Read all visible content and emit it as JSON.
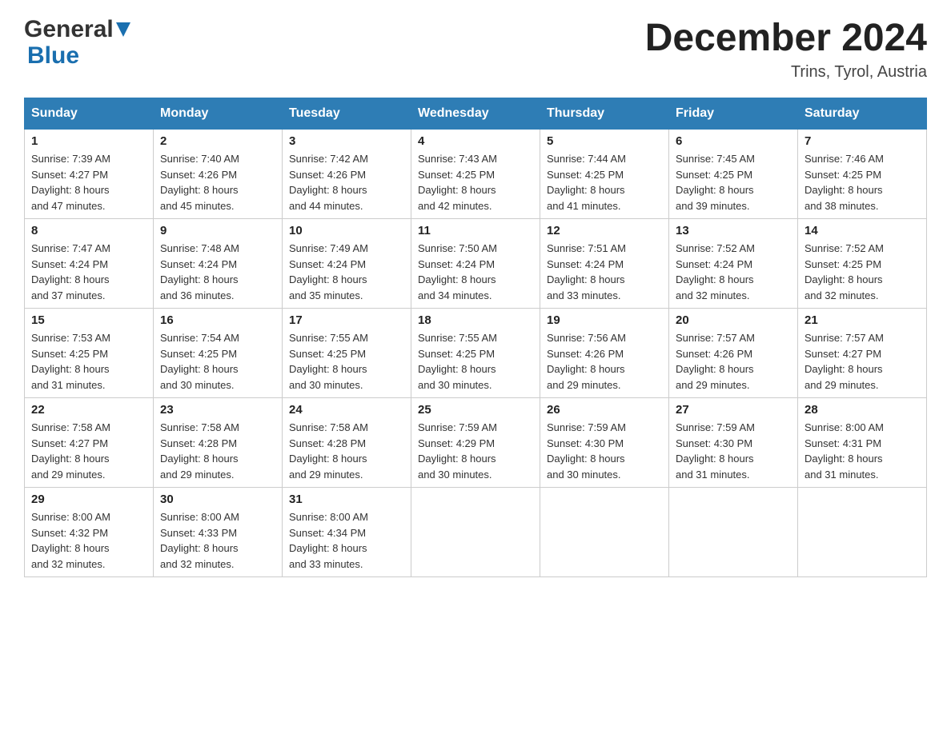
{
  "header": {
    "logo_general": "General",
    "logo_blue": "Blue",
    "month_title": "December 2024",
    "location": "Trins, Tyrol, Austria"
  },
  "days_of_week": [
    "Sunday",
    "Monday",
    "Tuesday",
    "Wednesday",
    "Thursday",
    "Friday",
    "Saturday"
  ],
  "weeks": [
    [
      {
        "day": "1",
        "sunrise": "7:39 AM",
        "sunset": "4:27 PM",
        "daylight": "8 hours and 47 minutes."
      },
      {
        "day": "2",
        "sunrise": "7:40 AM",
        "sunset": "4:26 PM",
        "daylight": "8 hours and 45 minutes."
      },
      {
        "day": "3",
        "sunrise": "7:42 AM",
        "sunset": "4:26 PM",
        "daylight": "8 hours and 44 minutes."
      },
      {
        "day": "4",
        "sunrise": "7:43 AM",
        "sunset": "4:25 PM",
        "daylight": "8 hours and 42 minutes."
      },
      {
        "day": "5",
        "sunrise": "7:44 AM",
        "sunset": "4:25 PM",
        "daylight": "8 hours and 41 minutes."
      },
      {
        "day": "6",
        "sunrise": "7:45 AM",
        "sunset": "4:25 PM",
        "daylight": "8 hours and 39 minutes."
      },
      {
        "day": "7",
        "sunrise": "7:46 AM",
        "sunset": "4:25 PM",
        "daylight": "8 hours and 38 minutes."
      }
    ],
    [
      {
        "day": "8",
        "sunrise": "7:47 AM",
        "sunset": "4:24 PM",
        "daylight": "8 hours and 37 minutes."
      },
      {
        "day": "9",
        "sunrise": "7:48 AM",
        "sunset": "4:24 PM",
        "daylight": "8 hours and 36 minutes."
      },
      {
        "day": "10",
        "sunrise": "7:49 AM",
        "sunset": "4:24 PM",
        "daylight": "8 hours and 35 minutes."
      },
      {
        "day": "11",
        "sunrise": "7:50 AM",
        "sunset": "4:24 PM",
        "daylight": "8 hours and 34 minutes."
      },
      {
        "day": "12",
        "sunrise": "7:51 AM",
        "sunset": "4:24 PM",
        "daylight": "8 hours and 33 minutes."
      },
      {
        "day": "13",
        "sunrise": "7:52 AM",
        "sunset": "4:24 PM",
        "daylight": "8 hours and 32 minutes."
      },
      {
        "day": "14",
        "sunrise": "7:52 AM",
        "sunset": "4:25 PM",
        "daylight": "8 hours and 32 minutes."
      }
    ],
    [
      {
        "day": "15",
        "sunrise": "7:53 AM",
        "sunset": "4:25 PM",
        "daylight": "8 hours and 31 minutes."
      },
      {
        "day": "16",
        "sunrise": "7:54 AM",
        "sunset": "4:25 PM",
        "daylight": "8 hours and 30 minutes."
      },
      {
        "day": "17",
        "sunrise": "7:55 AM",
        "sunset": "4:25 PM",
        "daylight": "8 hours and 30 minutes."
      },
      {
        "day": "18",
        "sunrise": "7:55 AM",
        "sunset": "4:25 PM",
        "daylight": "8 hours and 30 minutes."
      },
      {
        "day": "19",
        "sunrise": "7:56 AM",
        "sunset": "4:26 PM",
        "daylight": "8 hours and 29 minutes."
      },
      {
        "day": "20",
        "sunrise": "7:57 AM",
        "sunset": "4:26 PM",
        "daylight": "8 hours and 29 minutes."
      },
      {
        "day": "21",
        "sunrise": "7:57 AM",
        "sunset": "4:27 PM",
        "daylight": "8 hours and 29 minutes."
      }
    ],
    [
      {
        "day": "22",
        "sunrise": "7:58 AM",
        "sunset": "4:27 PM",
        "daylight": "8 hours and 29 minutes."
      },
      {
        "day": "23",
        "sunrise": "7:58 AM",
        "sunset": "4:28 PM",
        "daylight": "8 hours and 29 minutes."
      },
      {
        "day": "24",
        "sunrise": "7:58 AM",
        "sunset": "4:28 PM",
        "daylight": "8 hours and 29 minutes."
      },
      {
        "day": "25",
        "sunrise": "7:59 AM",
        "sunset": "4:29 PM",
        "daylight": "8 hours and 30 minutes."
      },
      {
        "day": "26",
        "sunrise": "7:59 AM",
        "sunset": "4:30 PM",
        "daylight": "8 hours and 30 minutes."
      },
      {
        "day": "27",
        "sunrise": "7:59 AM",
        "sunset": "4:30 PM",
        "daylight": "8 hours and 31 minutes."
      },
      {
        "day": "28",
        "sunrise": "8:00 AM",
        "sunset": "4:31 PM",
        "daylight": "8 hours and 31 minutes."
      }
    ],
    [
      {
        "day": "29",
        "sunrise": "8:00 AM",
        "sunset": "4:32 PM",
        "daylight": "8 hours and 32 minutes."
      },
      {
        "day": "30",
        "sunrise": "8:00 AM",
        "sunset": "4:33 PM",
        "daylight": "8 hours and 32 minutes."
      },
      {
        "day": "31",
        "sunrise": "8:00 AM",
        "sunset": "4:34 PM",
        "daylight": "8 hours and 33 minutes."
      },
      null,
      null,
      null,
      null
    ]
  ],
  "labels": {
    "sunrise": "Sunrise:",
    "sunset": "Sunset:",
    "daylight": "Daylight:"
  }
}
